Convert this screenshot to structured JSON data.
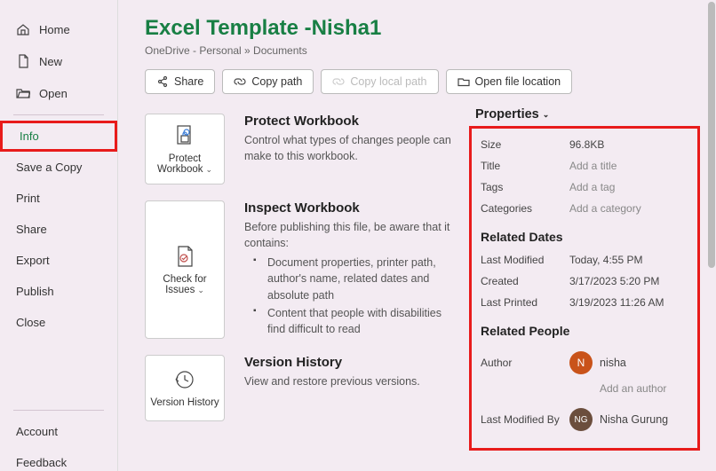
{
  "sidebar": {
    "home": "Home",
    "new": "New",
    "open": "Open",
    "info": "Info",
    "save_copy": "Save a Copy",
    "print": "Print",
    "share": "Share",
    "export": "Export",
    "publish": "Publish",
    "close": "Close",
    "account": "Account",
    "feedback": "Feedback"
  },
  "header": {
    "title": "Excel Template -Nisha1",
    "breadcrumb": "OneDrive - Personal » Documents"
  },
  "toolbar": {
    "share": "Share",
    "copy_path": "Copy path",
    "copy_local_path": "Copy local path",
    "open_location": "Open file location"
  },
  "sections": {
    "protect": {
      "card": "Protect Workbook",
      "title": "Protect Workbook",
      "desc": "Control what types of changes people can make to this workbook."
    },
    "inspect": {
      "card": "Check for Issues",
      "title": "Inspect Workbook",
      "desc": "Before publishing this file, be aware that it contains:",
      "item1": "Document properties, printer path, author's name, related dates and absolute path",
      "item2": "Content that people with disabilities find difficult to read"
    },
    "version": {
      "card": "Version History",
      "title": "Version History",
      "desc": "View and restore previous versions."
    }
  },
  "props": {
    "heading": "Properties",
    "size_label": "Size",
    "size_val": "96.8KB",
    "title_label": "Title",
    "title_ph": "Add a title",
    "tags_label": "Tags",
    "tags_ph": "Add a tag",
    "categories_label": "Categories",
    "categories_ph": "Add a category",
    "dates_heading": "Related Dates",
    "modified_label": "Last Modified",
    "modified_val": "Today, 4:55 PM",
    "created_label": "Created",
    "created_val": "3/17/2023 5:20 PM",
    "printed_label": "Last Printed",
    "printed_val": "3/19/2023 11:26 AM",
    "people_heading": "Related People",
    "author_label": "Author",
    "author_initial": "N",
    "author_name": "nisha",
    "add_author": "Add an author",
    "modifiedby_label": "Last Modified By",
    "modifiedby_initial": "NG",
    "modifiedby_name": "Nisha Gurung"
  }
}
